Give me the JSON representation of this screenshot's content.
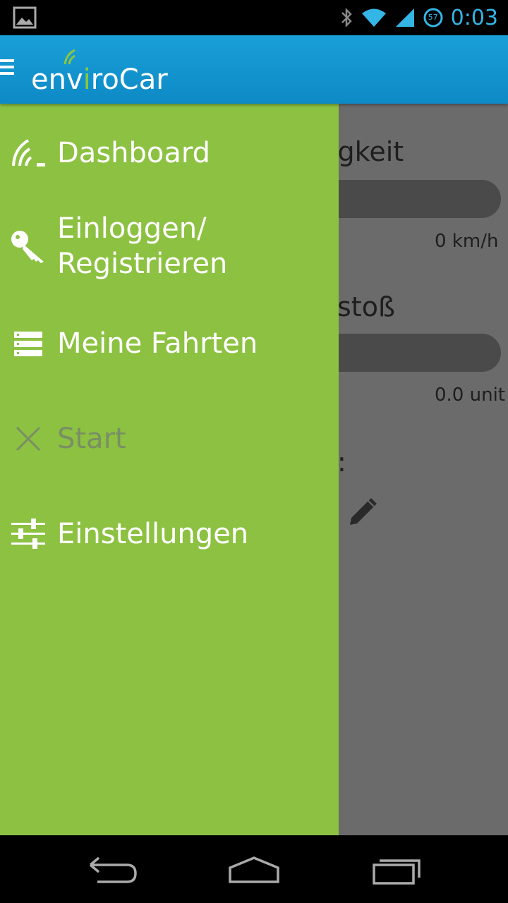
{
  "status_bar": {
    "time": "0:03",
    "battery_level": "57",
    "icons": [
      "gallery-icon",
      "bluetooth-icon",
      "wifi-icon",
      "signal-icon",
      "battery-icon"
    ]
  },
  "action_bar": {
    "app_title_prefix": "env",
    "app_title_i": "i",
    "app_title_suffix": "roCar",
    "brand_color": "#1a9fd8",
    "accent_color": "#8cc63f"
  },
  "drawer": {
    "background": "#8cc142",
    "items": [
      {
        "label": "Dashboard",
        "icon": "signal-arcs-icon",
        "enabled": true
      },
      {
        "label_line1": "Einloggen/",
        "label_line2": "Registrieren",
        "icon": "key-icon",
        "enabled": true
      },
      {
        "label": "Meine Fahrten",
        "icon": "list-icon",
        "enabled": true
      },
      {
        "label": "Start",
        "icon": "close-icon",
        "enabled": false
      },
      {
        "label": "Einstellungen",
        "icon": "sliders-icon",
        "enabled": true
      }
    ]
  },
  "dashboard": {
    "speed_label_partial": "igkeit",
    "speed_value": "0 km/h",
    "co2_label_partial": "stoß",
    "co2_value": "0.0 unit",
    "car_label_partial": ":",
    "car_value_partial": ")"
  },
  "nav_bar": {
    "icons": [
      "back-icon",
      "home-icon",
      "recents-icon"
    ]
  }
}
